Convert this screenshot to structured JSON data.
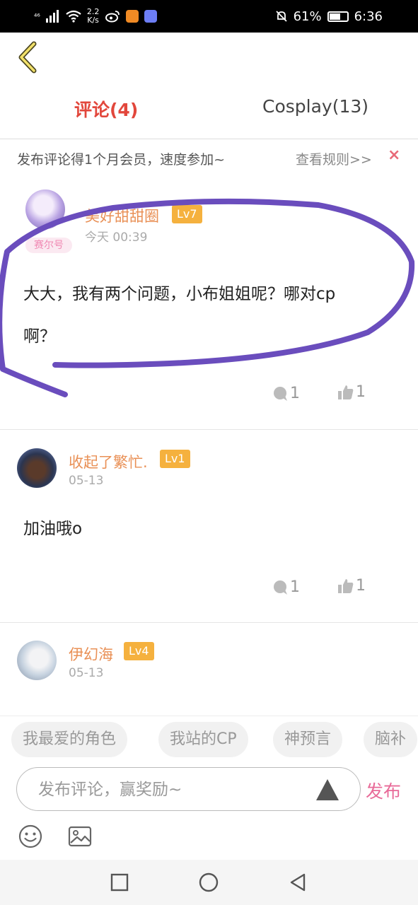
{
  "status_bar": {
    "signal": "⁴⁶",
    "speed_value": "2.2",
    "speed_unit": "K/s",
    "battery": "61%",
    "time": "6:36"
  },
  "tabs": [
    {
      "label": "评论(4)",
      "active": true
    },
    {
      "label": "Cosplay(13)",
      "active": false
    }
  ],
  "promo": {
    "text": "发布评论得1个月会员，速度参加~",
    "rules_link": "查看规则>>",
    "close_symbol": "×"
  },
  "comments": [
    {
      "username": "美好甜甜圈",
      "level": "Lv7",
      "badge": "赛尔号",
      "time": "今天 00:39",
      "text_line1": "大大，我有两个问题，小布姐姐呢？哪对cp",
      "text_line2": "啊？",
      "replies": "1",
      "likes": "1"
    },
    {
      "username": "收起了繁忙.",
      "level": "Lv1",
      "time": "05-13",
      "text_line1": "加油哦o",
      "replies": "1",
      "likes": "1"
    },
    {
      "username": "伊幻海",
      "level": "Lv4",
      "time": "05-13"
    }
  ],
  "chips": [
    "我最爱的角色",
    "我站的CP",
    "神预言",
    "脑补"
  ],
  "input": {
    "placeholder": "发布评论，赢奖励~",
    "publish_label": "发布"
  },
  "colors": {
    "tab_active": "#e2473c",
    "username": "#e99056",
    "level_badge": "#f5b13e",
    "publish": "#e86a98",
    "highlight_stroke": "#6a4dbd"
  }
}
